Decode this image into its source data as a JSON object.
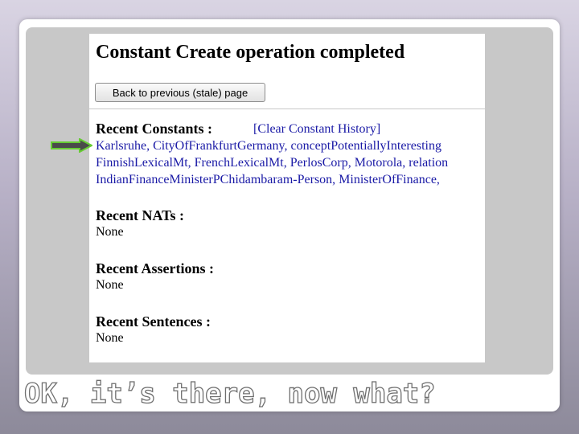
{
  "page": {
    "title": "Constant Create operation completed",
    "back_button": "Back to previous (stale) page"
  },
  "recent_constants": {
    "heading": "Recent Constants :",
    "clear_link": "[Clear Constant History]",
    "lines": [
      [
        {
          "text": "Karlsruhe",
          "sep": ", "
        },
        {
          "text": "CityOfFrankfurtGermany",
          "sep": ", "
        },
        {
          "text": "conceptPotentiallyInteresting",
          "sep": ""
        }
      ],
      [
        {
          "text": "FinnishLexicalMt",
          "sep": ", "
        },
        {
          "text": "FrenchLexicalMt",
          "sep": ", "
        },
        {
          "text": "PerlosCorp",
          "sep": ", "
        },
        {
          "text": "Motorola",
          "sep": ", "
        },
        {
          "text": "relation",
          "sep": ""
        }
      ],
      [
        {
          "text": "IndianFinanceMinisterPChidambaram-Person",
          "sep": ", "
        },
        {
          "text": "MinisterOfFinance",
          "sep": ","
        }
      ]
    ]
  },
  "recent_nats": {
    "heading": "Recent NATs :",
    "value": "None"
  },
  "recent_assertions": {
    "heading": "Recent Assertions :",
    "value": "None"
  },
  "recent_sentences": {
    "heading": "Recent Sentences :",
    "value": "None"
  },
  "caption": "OK, it’s there, now what?",
  "colors": {
    "link": "#1a1aa6",
    "arrow_fill": "#4a4a4a",
    "arrow_outline": "#66cc33"
  },
  "icons": {
    "pointer_arrow": "right-arrow-icon"
  }
}
